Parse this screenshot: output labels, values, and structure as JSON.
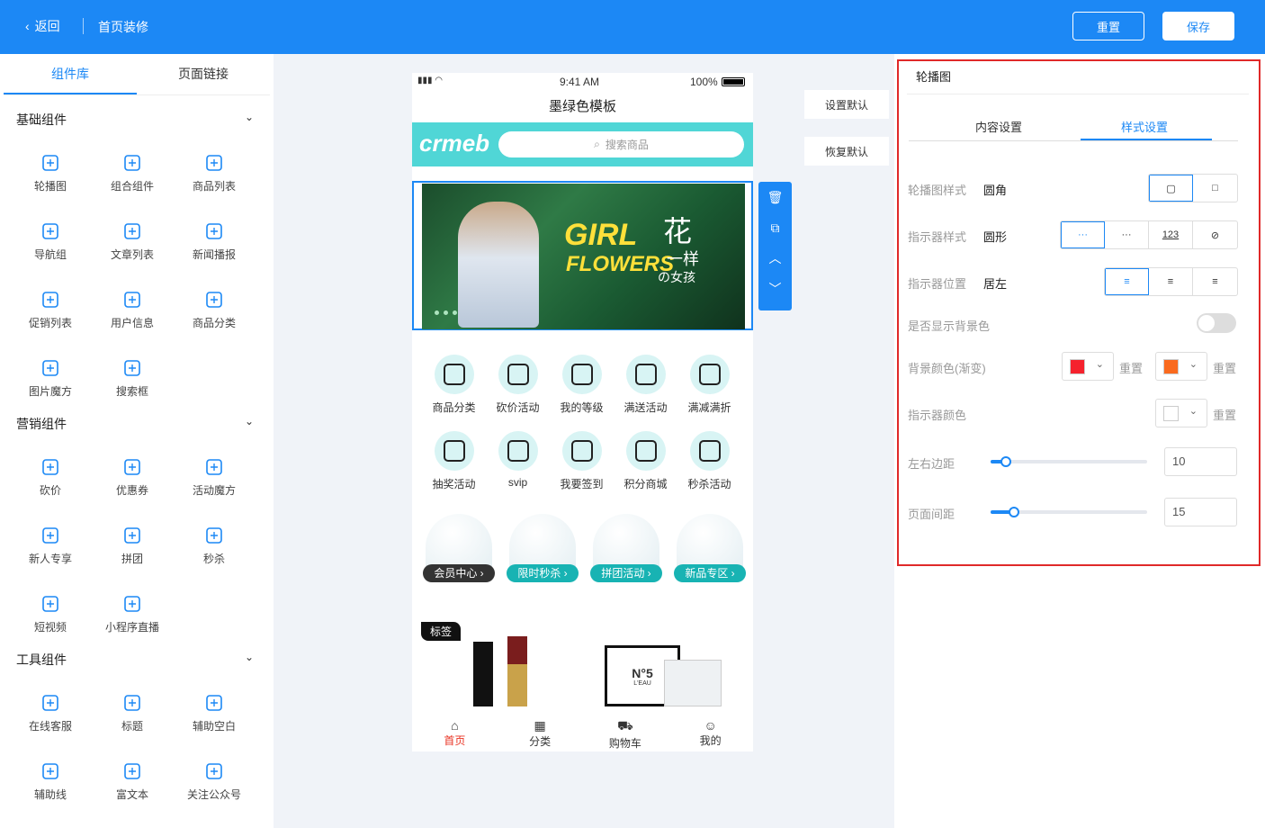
{
  "header": {
    "back_label": "返回",
    "title": "首页装修",
    "reset_label": "重置",
    "save_label": "保存"
  },
  "left_panel": {
    "tabs": [
      "组件库",
      "页面链接"
    ],
    "sections": [
      {
        "title": "基础组件",
        "items": [
          "轮播图",
          "组合组件",
          "商品列表",
          "导航组",
          "文章列表",
          "新闻播报",
          "促销列表",
          "用户信息",
          "商品分类",
          "图片魔方",
          "搜索框"
        ]
      },
      {
        "title": "营销组件",
        "items": [
          "砍价",
          "优惠券",
          "活动魔方",
          "新人专享",
          "拼团",
          "秒杀",
          "短视频",
          "小程序直播"
        ]
      },
      {
        "title": "工具组件",
        "items": [
          "在线客服",
          "标题",
          "辅助空白",
          "辅助线",
          "富文本",
          "关注公众号"
        ]
      }
    ]
  },
  "phone": {
    "status_time": "9:41 AM",
    "battery": "100%",
    "template_title": "墨绿色模板",
    "logo_text": "crmeb",
    "search_placeholder": "搜索商品",
    "banner_text_1": "GIRL",
    "banner_text_2": "FLOWERS",
    "banner_text_3": "花",
    "banner_text_4": "一样",
    "banner_text_5": "の女孩",
    "nav_items": [
      "商品分类",
      "砍价活动",
      "我的等级",
      "满送活动",
      "满减满折",
      "抽奖活动",
      "svip",
      "我要签到",
      "积分商城",
      "秒杀活动"
    ],
    "globes": [
      "会员中心 ›",
      "限时秒杀 ›",
      "拼团活动 ›",
      "新品专区 ›"
    ],
    "tag_label": "标签",
    "perfume_text": "N°5",
    "perfume_sub": "L'EAU",
    "tabbar": [
      "首页",
      "分类",
      "购物车",
      "我的"
    ]
  },
  "side_buttons": [
    "设置默认",
    "恢复默认"
  ],
  "right_panel": {
    "title": "轮播图",
    "tabs": [
      "内容设置",
      "样式设置"
    ],
    "rows": {
      "carousel_style": {
        "label": "轮播图样式",
        "value": "圆角"
      },
      "indicator_style": {
        "label": "指示器样式",
        "value": "圆形",
        "option_num": "123"
      },
      "indicator_pos": {
        "label": "指示器位置",
        "value": "居左"
      },
      "show_bg": {
        "label": "是否显示背景色"
      },
      "bg_color": {
        "label": "背景颜色(渐变)",
        "reset": "重置",
        "color1": "#f5222d",
        "color2": "#fa6a1e"
      },
      "ind_color": {
        "label": "指示器颜色",
        "reset": "重置"
      },
      "lr_margin": {
        "label": "左右边距",
        "value": "10"
      },
      "page_gap": {
        "label": "页面间距",
        "value": "15"
      }
    }
  }
}
